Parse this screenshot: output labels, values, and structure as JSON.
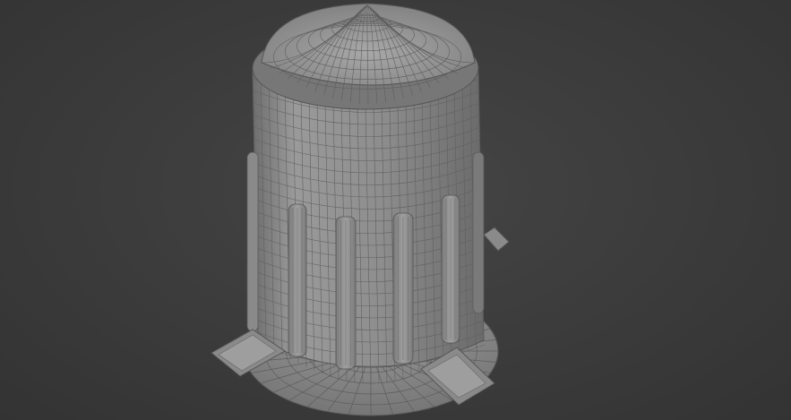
{
  "viewport": {
    "type": "3d-perspective-viewport",
    "shading": "wireframe-over-shaded",
    "background_color": "#3a3a3a"
  },
  "model": {
    "object": "cylindrical-tower-mesh",
    "body_color": "#8c8c8c",
    "wire_color": "#5a5a5a",
    "parts": [
      "dome-cap",
      "cylinder-body",
      "vertical-vents",
      "base-disc",
      "feet"
    ],
    "vent_count": 4,
    "foot_count": 3
  }
}
